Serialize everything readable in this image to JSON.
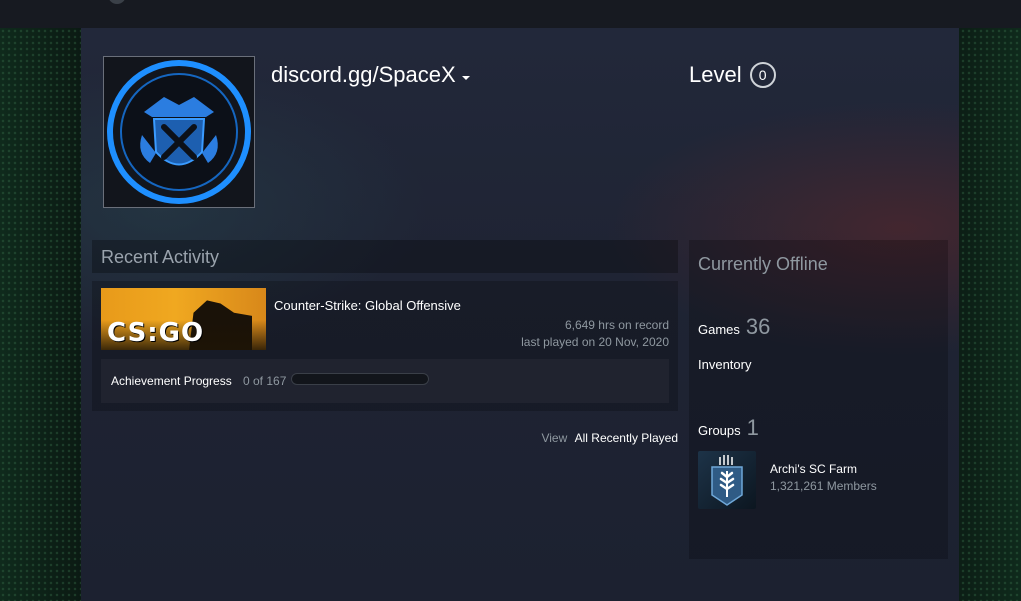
{
  "profile": {
    "persona_name": "discord.gg/SpaceX",
    "level_label": "Level",
    "level_value": "0"
  },
  "recent_activity": {
    "header": "Recent Activity",
    "game": {
      "name": "Counter-Strike: Global Offensive",
      "capsule_text": "CS:GO",
      "hours": "6,649 hrs on record",
      "last_played": "last played on 20 Nov, 2020"
    },
    "achievements": {
      "label": "Achievement Progress",
      "count": "0 of 167",
      "progress_fraction": 0
    },
    "view_all_prefix": "View",
    "view_all_link": "All Recently Played"
  },
  "sidebar": {
    "status": "Currently Offline",
    "games_label": "Games",
    "games_count": "36",
    "inventory_label": "Inventory",
    "groups_label": "Groups",
    "groups_count": "1",
    "group": {
      "name": "Archi's SC Farm",
      "members": "1,321,261 Members"
    }
  },
  "colors": {
    "accent_blue": "#1e8fff",
    "csgo_orange": "#f0a820",
    "muted_text": "#8f98a0"
  }
}
